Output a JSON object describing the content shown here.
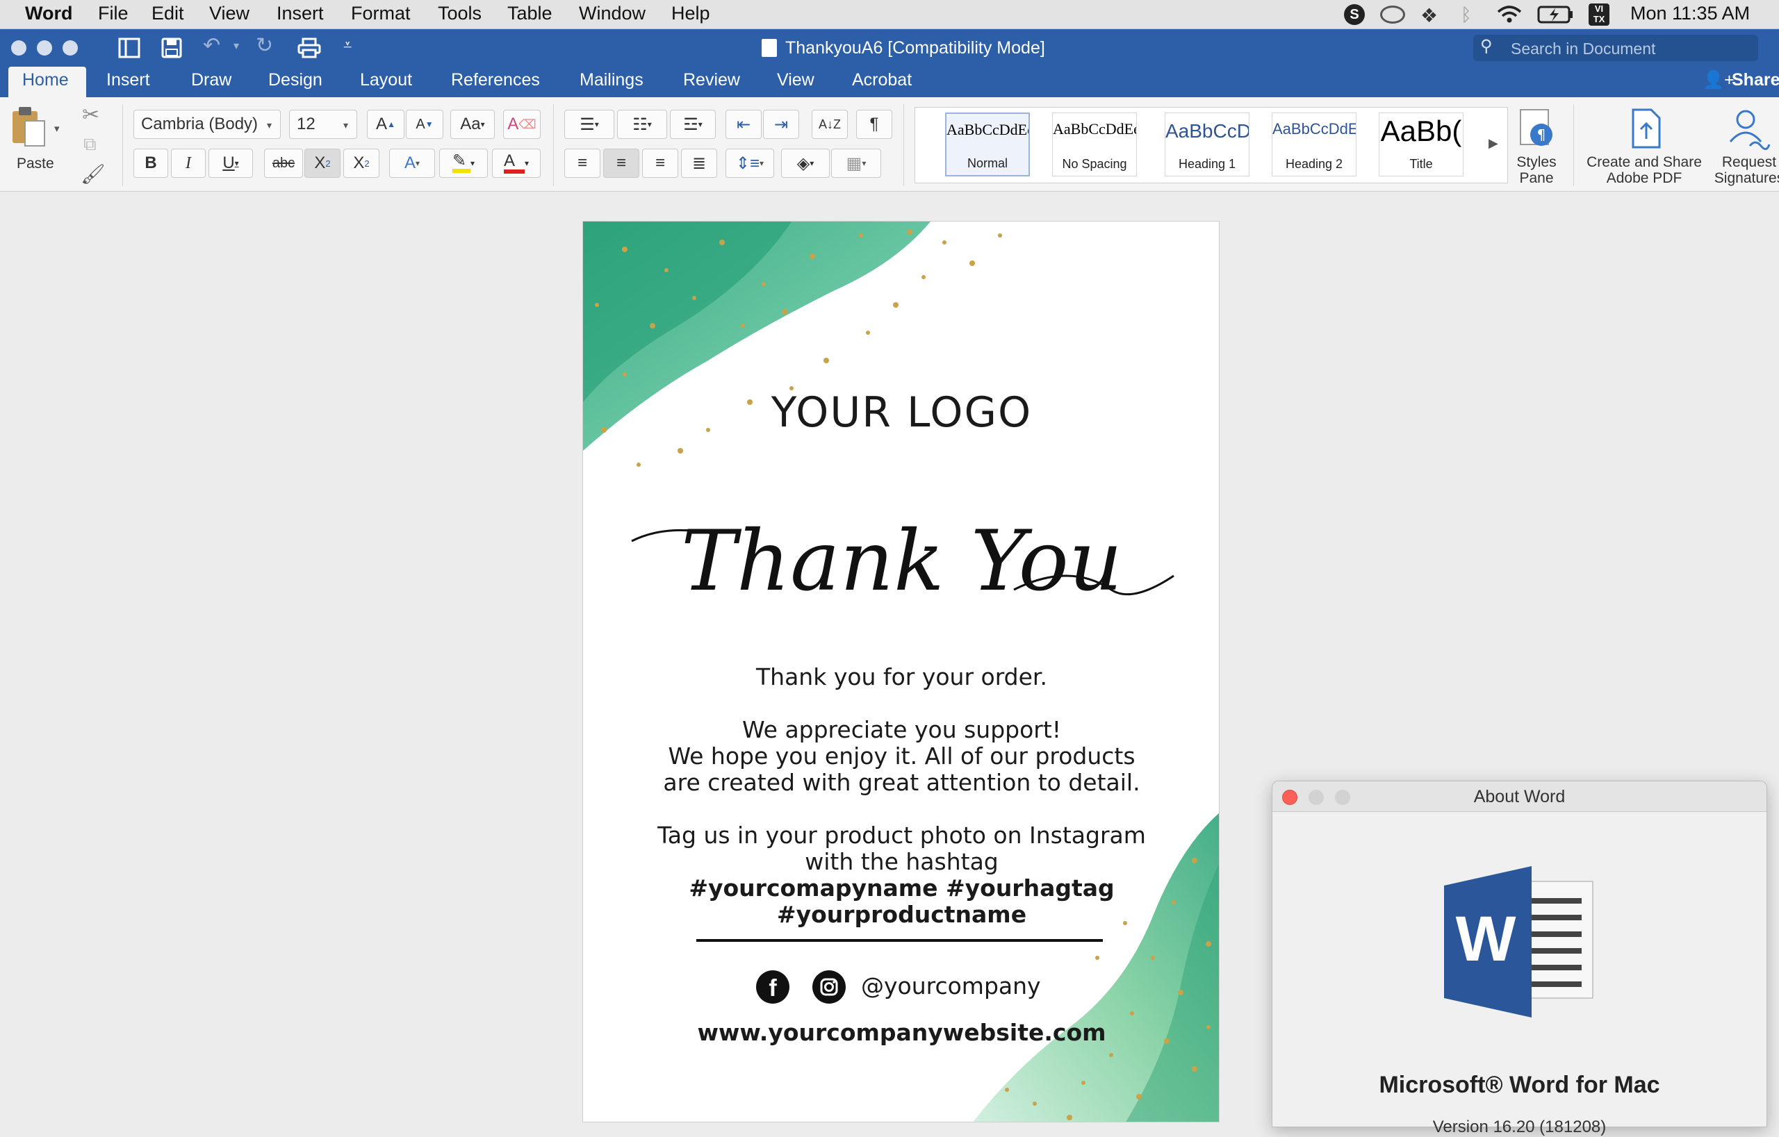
{
  "menubar": {
    "app": "Word",
    "items": [
      "File",
      "Edit",
      "View",
      "Insert",
      "Format",
      "Tools",
      "Table",
      "Window",
      "Help"
    ],
    "clock": "Mon 11:35 AM"
  },
  "window": {
    "title": "ThankyouA6 [Compatibility Mode]",
    "search_placeholder": "Search in Document"
  },
  "tabs": [
    "Home",
    "Insert",
    "Draw",
    "Design",
    "Layout",
    "References",
    "Mailings",
    "Review",
    "View",
    "Acrobat"
  ],
  "share_label": "Share",
  "ribbon": {
    "paste_label": "Paste",
    "font_name": "Cambria (Body)",
    "font_size": "12",
    "styles": [
      {
        "preview": "AaBbCcDdEe",
        "name": "Normal"
      },
      {
        "preview": "AaBbCcDdEe",
        "name": "No Spacing"
      },
      {
        "preview": "AaBbCcDc",
        "name": "Heading 1"
      },
      {
        "preview": "AaBbCcDdEe",
        "name": "Heading 2"
      },
      {
        "preview": "AaBb(",
        "name": "Title"
      }
    ],
    "styles_pane": [
      "Styles",
      "Pane"
    ],
    "create_share": [
      "Create and Share",
      "Adobe PDF"
    ],
    "request_sig": [
      "Request",
      "Signatures"
    ]
  },
  "document": {
    "logo": "YOUR LOGO",
    "script_text": "Thank You",
    "line1": "Thank you for your order.",
    "line2": "We appreciate you support!",
    "line3": "We hope you enjoy it. All of our products",
    "line4": "are created with great attention to detail.",
    "line5": "Tag us in your product photo on Instagram",
    "line6": "with the hashtag",
    "hashtag1": "#yourcomapyname #yourhagtag",
    "hashtag2": "#yourproductname",
    "handle": "@yourcompany",
    "website": "www.yourcompanywebsite.com"
  },
  "about": {
    "title": "About Word",
    "product": "Microsoft® Word for Mac",
    "version": "Version 16.20 (181208)"
  },
  "colors": {
    "title_blue": "#2c5fa8",
    "word_icon_blue": "#2b579a",
    "watercolor_green": "#3fae83",
    "gold_glitter": "#c9a24a",
    "font_red": "#e02020",
    "highlight_yellow": "#f5e000"
  }
}
